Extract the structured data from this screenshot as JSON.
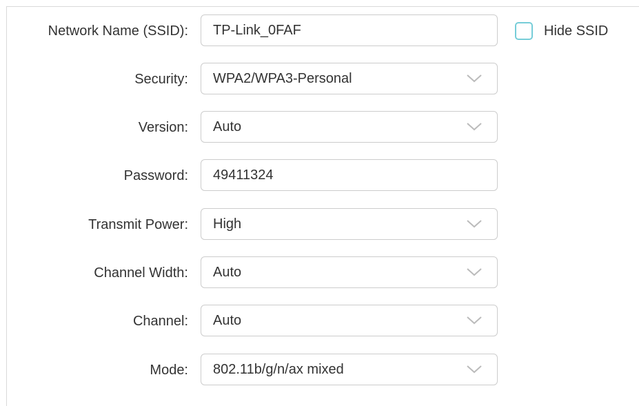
{
  "network_name": {
    "label": "Network Name (SSID):",
    "value": "TP-Link_0FAF",
    "hide_ssid": {
      "label": "Hide SSID",
      "checked": false
    }
  },
  "security": {
    "label": "Security:",
    "value": "WPA2/WPA3-Personal",
    "icon": "chevron-down-icon"
  },
  "version": {
    "label": "Version:",
    "value": "Auto",
    "icon": "chevron-down-icon"
  },
  "password": {
    "label": "Password:",
    "value": "49411324"
  },
  "transmit_power": {
    "label": "Transmit Power:",
    "value": "High",
    "icon": "chevron-down-icon"
  },
  "channel_width": {
    "label": "Channel Width:",
    "value": "Auto",
    "icon": "chevron-down-icon"
  },
  "channel": {
    "label": "Channel:",
    "value": "Auto",
    "icon": "chevron-down-icon"
  },
  "mode": {
    "label": "Mode:",
    "value": "802.11b/g/n/ax mixed",
    "icon": "chevron-down-icon"
  },
  "colors": {
    "text": "#333333",
    "border": "#cccccc",
    "checkbox_border": "#76cdd8",
    "chevron": "#bbbbbb"
  }
}
